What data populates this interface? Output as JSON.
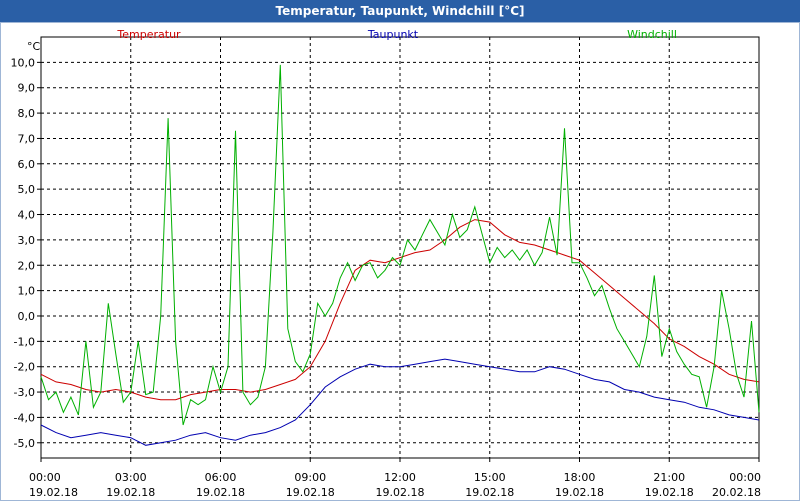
{
  "window": {
    "title": "Temperatur, Taupunkt, Windchill [°C]"
  },
  "colors": {
    "title_bar": "#2a5fa6",
    "Temperatur": "#cc0000",
    "Taupunkt": "#0000b0",
    "Windchill": "#00b000",
    "grid": "#000000"
  },
  "chart_data": {
    "type": "line",
    "title": "Temperatur, Taupunkt, Windchill [°C]",
    "ylabel": "°C",
    "grid": true,
    "legend_position": "top",
    "x_ticks": [
      {
        "time": "00:00",
        "date": "19.02.18"
      },
      {
        "time": "03:00",
        "date": "19.02.18"
      },
      {
        "time": "06:00",
        "date": "19.02.18"
      },
      {
        "time": "09:00",
        "date": "19.02.18"
      },
      {
        "time": "12:00",
        "date": "19.02.18"
      },
      {
        "time": "15:00",
        "date": "19.02.18"
      },
      {
        "time": "18:00",
        "date": "19.02.18"
      },
      {
        "time": "21:00",
        "date": "19.02.18"
      },
      {
        "time": "00:00",
        "date": "20.02.18"
      }
    ],
    "y_ticks": [
      "10,0",
      "9,0",
      "8,0",
      "7,0",
      "6,0",
      "5,0",
      "4,0",
      "3,0",
      "2,0",
      "1,0",
      "0,0",
      "-1,0",
      "-2,0",
      "-3,0",
      "-4,0",
      "-5,0"
    ],
    "ylim": [
      -5.6,
      11.0
    ],
    "x_hours": [
      0,
      24
    ],
    "series": [
      {
        "name": "Temperatur",
        "x": [
          0,
          0.5,
          1,
          1.5,
          2,
          2.5,
          3,
          3.5,
          4,
          4.5,
          5,
          5.5,
          6,
          6.5,
          7,
          7.5,
          8,
          8.5,
          9,
          9.5,
          10,
          10.5,
          11,
          11.5,
          12,
          12.5,
          13,
          13.5,
          14,
          14.5,
          15,
          15.5,
          16,
          16.5,
          17,
          17.5,
          18,
          18.5,
          19,
          19.5,
          20,
          20.5,
          21,
          21.5,
          22,
          22.5,
          23,
          23.5,
          24
        ],
        "values": [
          -2.3,
          -2.6,
          -2.7,
          -2.9,
          -3.0,
          -2.9,
          -3.0,
          -3.2,
          -3.3,
          -3.3,
          -3.1,
          -3.0,
          -2.9,
          -2.9,
          -3.0,
          -2.9,
          -2.7,
          -2.5,
          -2.0,
          -1.0,
          0.5,
          1.8,
          2.2,
          2.1,
          2.3,
          2.5,
          2.6,
          3.0,
          3.5,
          3.8,
          3.7,
          3.2,
          2.9,
          2.8,
          2.6,
          2.4,
          2.2,
          1.7,
          1.2,
          0.7,
          0.2,
          -0.3,
          -0.9,
          -1.2,
          -1.6,
          -1.9,
          -2.3,
          -2.5,
          -2.6
        ]
      },
      {
        "name": "Taupunkt",
        "x": [
          0,
          0.5,
          1,
          1.5,
          2,
          2.5,
          3,
          3.5,
          4,
          4.5,
          5,
          5.5,
          6,
          6.5,
          7,
          7.5,
          8,
          8.5,
          9,
          9.5,
          10,
          10.5,
          11,
          11.5,
          12,
          12.5,
          13,
          13.5,
          14,
          14.5,
          15,
          15.5,
          16,
          16.5,
          17,
          17.5,
          18,
          18.5,
          19,
          19.5,
          20,
          20.5,
          21,
          21.5,
          22,
          22.5,
          23,
          23.5,
          24
        ],
        "values": [
          -4.3,
          -4.6,
          -4.8,
          -4.7,
          -4.6,
          -4.7,
          -4.8,
          -5.1,
          -5.0,
          -4.9,
          -4.7,
          -4.6,
          -4.8,
          -4.9,
          -4.7,
          -4.6,
          -4.4,
          -4.1,
          -3.5,
          -2.8,
          -2.4,
          -2.1,
          -1.9,
          -2.0,
          -2.0,
          -1.9,
          -1.8,
          -1.7,
          -1.8,
          -1.9,
          -2.0,
          -2.1,
          -2.2,
          -2.2,
          -2.0,
          -2.1,
          -2.3,
          -2.5,
          -2.6,
          -2.9,
          -3.0,
          -3.2,
          -3.3,
          -3.4,
          -3.6,
          -3.7,
          -3.9,
          -4.0,
          -4.1
        ]
      },
      {
        "name": "Windchill",
        "x": [
          0,
          0.25,
          0.5,
          0.75,
          1,
          1.25,
          1.5,
          1.75,
          2,
          2.25,
          2.5,
          2.75,
          3,
          3.25,
          3.5,
          3.75,
          4,
          4.25,
          4.5,
          4.75,
          5,
          5.25,
          5.5,
          5.75,
          6,
          6.25,
          6.5,
          6.75,
          7,
          7.25,
          7.5,
          7.75,
          8,
          8.25,
          8.5,
          8.75,
          9,
          9.25,
          9.5,
          9.75,
          10,
          10.25,
          10.5,
          10.75,
          11,
          11.25,
          11.5,
          11.75,
          12,
          12.25,
          12.5,
          12.75,
          13,
          13.25,
          13.5,
          13.75,
          14,
          14.25,
          14.5,
          14.75,
          15,
          15.25,
          15.5,
          15.75,
          16,
          16.25,
          16.5,
          16.75,
          17,
          17.25,
          17.5,
          17.75,
          18,
          18.25,
          18.5,
          18.75,
          19,
          19.25,
          19.5,
          19.75,
          20,
          20.25,
          20.5,
          20.75,
          21,
          21.25,
          21.5,
          21.75,
          22,
          22.25,
          22.5,
          22.75,
          23,
          23.25,
          23.5,
          23.75,
          24
        ],
        "values": [
          -2.4,
          -3.3,
          -3.0,
          -3.8,
          -3.2,
          -3.9,
          -1.0,
          -3.6,
          -3.0,
          0.5,
          -1.5,
          -3.4,
          -3.0,
          -1.0,
          -3.1,
          -3.0,
          0.0,
          7.8,
          -1.0,
          -4.3,
          -3.3,
          -3.5,
          -3.3,
          -2.0,
          -3.0,
          -2.0,
          7.3,
          -3.0,
          -3.5,
          -3.2,
          -2.0,
          3.3,
          9.9,
          -0.5,
          -1.8,
          -2.2,
          -1.5,
          0.5,
          0.0,
          0.5,
          1.5,
          2.1,
          1.4,
          2.0,
          2.1,
          1.5,
          1.8,
          2.3,
          2.0,
          3.0,
          2.6,
          3.2,
          3.8,
          3.3,
          2.8,
          4.0,
          3.1,
          3.4,
          4.3,
          3.2,
          2.1,
          2.7,
          2.3,
          2.6,
          2.2,
          2.6,
          2.0,
          2.5,
          3.9,
          2.4,
          7.4,
          2.1,
          2.1,
          1.5,
          0.8,
          1.2,
          0.3,
          -0.5,
          -1.0,
          -1.5,
          -2.0,
          -0.8,
          1.6,
          -1.6,
          -0.5,
          -1.4,
          -1.9,
          -2.3,
          -2.4,
          -3.6,
          -2.0,
          1.0,
          -0.5,
          -2.3,
          -3.2,
          -0.2,
          -3.8
        ]
      }
    ]
  }
}
